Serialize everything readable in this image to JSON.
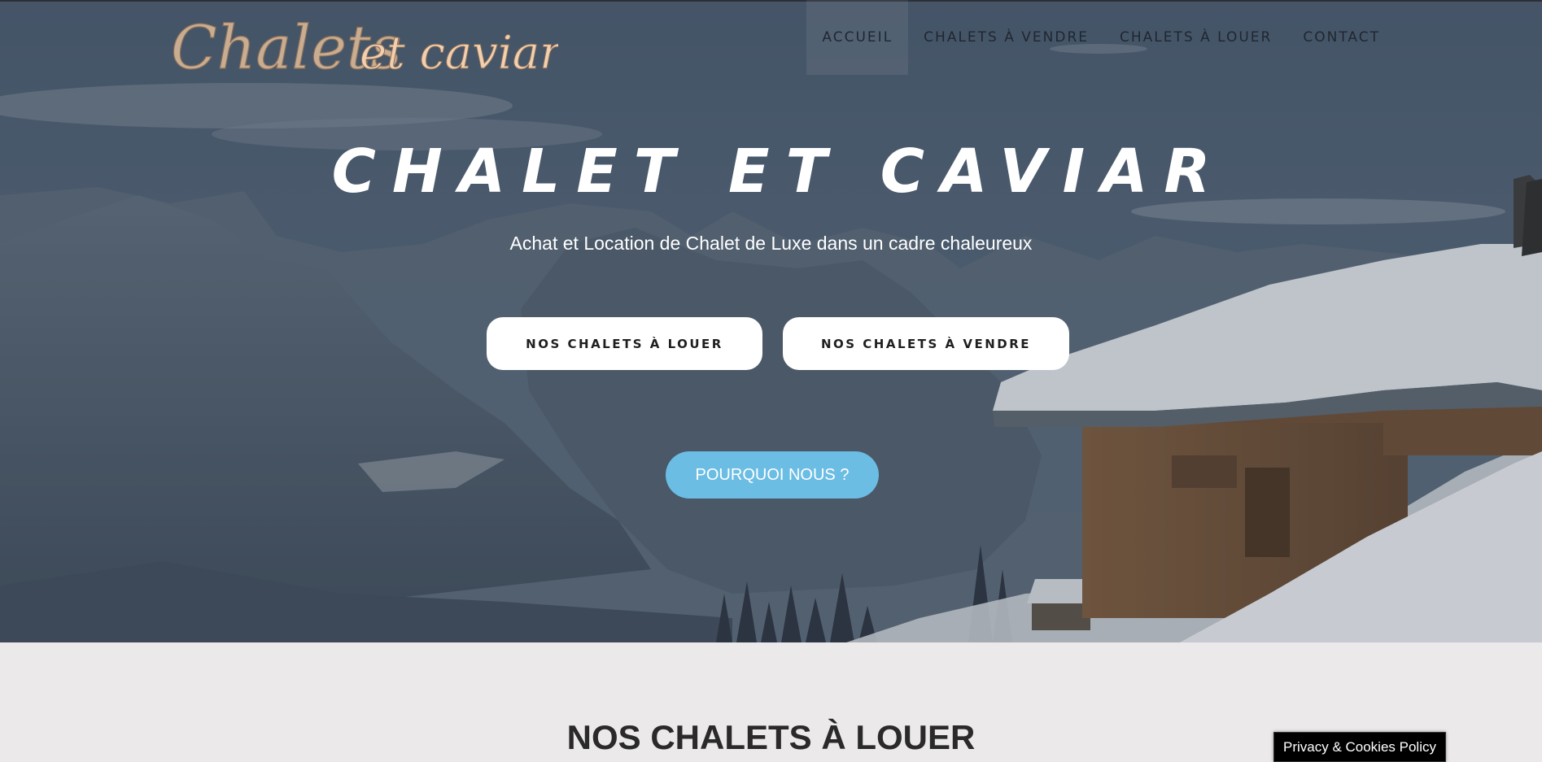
{
  "brand": {
    "logo_text": "Chalets et caviar",
    "logo_color": "#d6b898"
  },
  "nav": {
    "items": [
      {
        "label": "ACCUEIL",
        "active": true
      },
      {
        "label": "CHALETS À VENDRE",
        "active": false
      },
      {
        "label": "CHALETS À LOUER",
        "active": false
      },
      {
        "label": "CONTACT",
        "active": false
      }
    ]
  },
  "hero": {
    "title": "CHALET ET CAVIAR",
    "subtitle": "Achat et Location de Chalet de Luxe dans un cadre chaleureux",
    "buttons": {
      "rent_label": "NOS CHALETS À LOUER",
      "sale_label": "NOS CHALETS À VENDRE",
      "why_label": "POURQUOI NOUS ?"
    },
    "why_button_color": "#6bbde4"
  },
  "section": {
    "title": "NOS CHALETS À LOUER"
  },
  "cookie": {
    "label": "Privacy & Cookies Policy"
  }
}
